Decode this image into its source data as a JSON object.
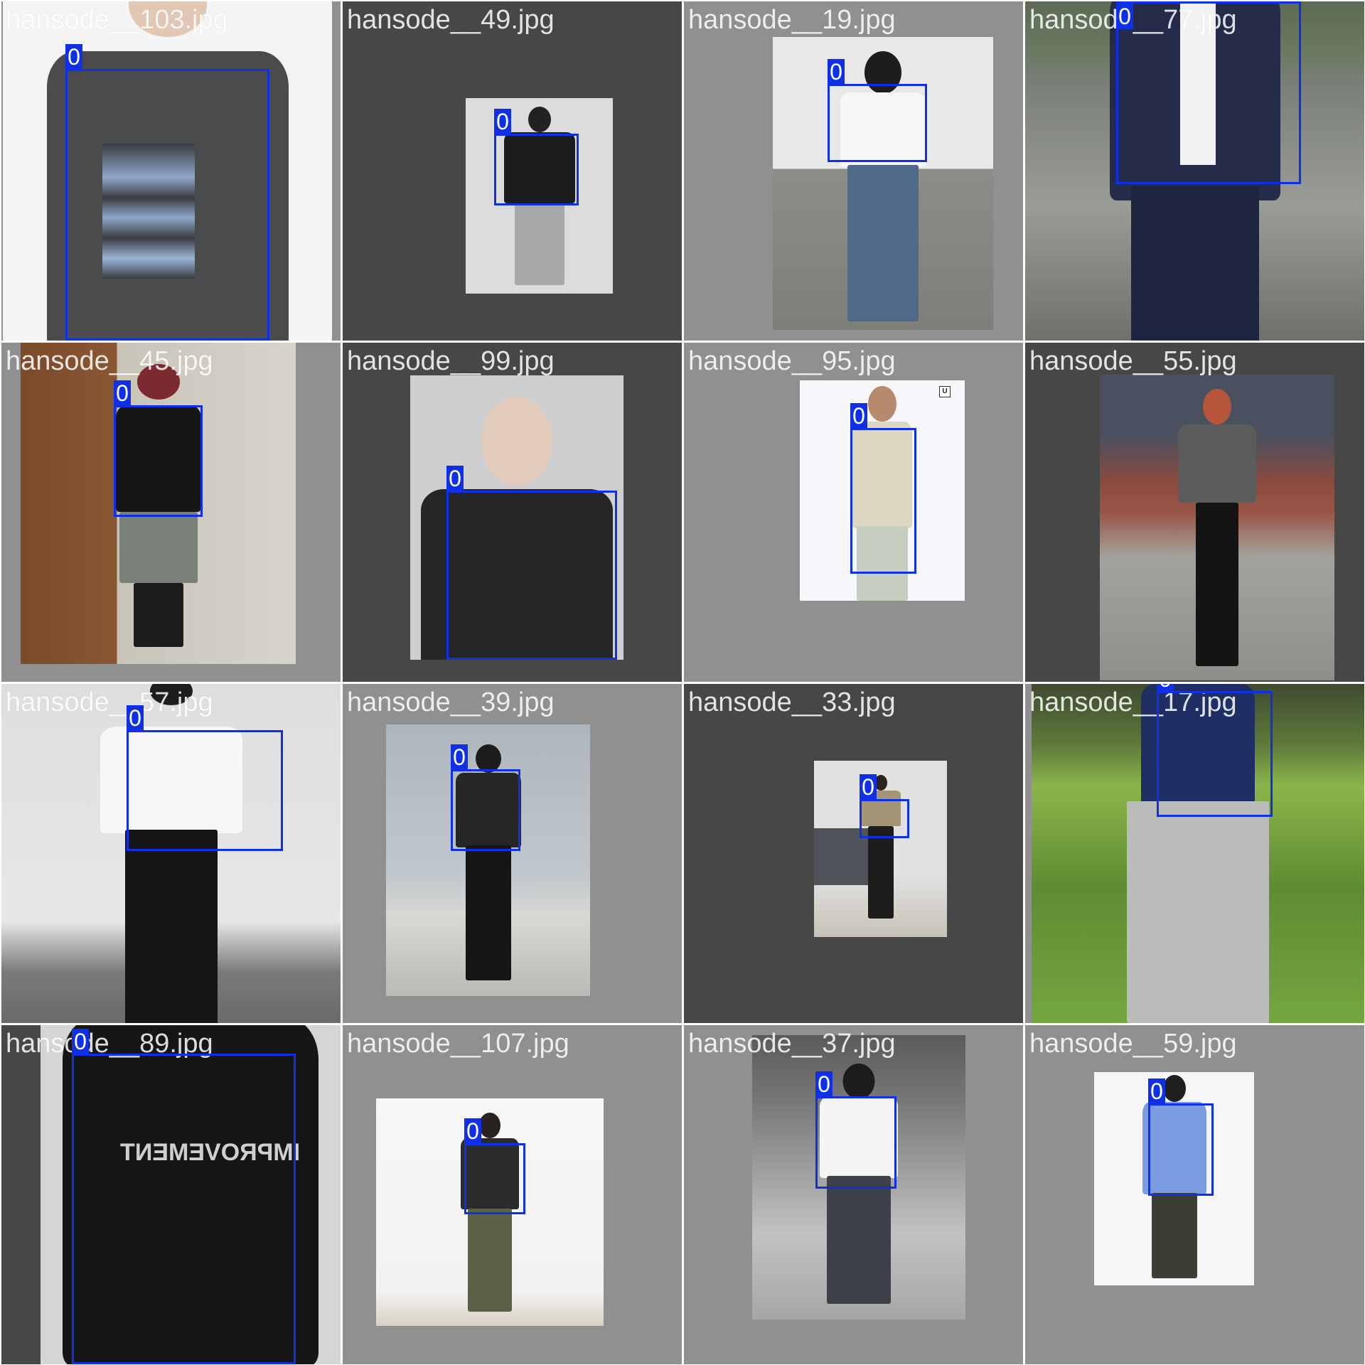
{
  "tiles": [
    {
      "file": "hansode__103.jpg",
      "label": "0"
    },
    {
      "file": "hansode__49.jpg",
      "label": "0"
    },
    {
      "file": "hansode__19.jpg",
      "label": "0"
    },
    {
      "file": "hansode__77.jpg",
      "label": "0"
    },
    {
      "file": "hansode__45.jpg",
      "label": "0"
    },
    {
      "file": "hansode__99.jpg",
      "label": "0"
    },
    {
      "file": "hansode__95.jpg",
      "label": "0"
    },
    {
      "file": "hansode__55.jpg",
      "label": "0"
    },
    {
      "file": "hansode__57.jpg",
      "label": "0"
    },
    {
      "file": "hansode__39.jpg",
      "label": "0"
    },
    {
      "file": "hansode__33.jpg",
      "label": "0"
    },
    {
      "file": "hansode__17.jpg",
      "label": "0"
    },
    {
      "file": "hansode__89.jpg",
      "label": "0"
    },
    {
      "file": "hansode__107.jpg",
      "label": "0"
    },
    {
      "file": "hansode__37.jpg",
      "label": "0"
    },
    {
      "file": "hansode__59.jpg",
      "label": "0"
    }
  ],
  "texts": {
    "shirt_print": "IMPROVEMENT",
    "logo": "U"
  },
  "colors": {
    "box": "#1030e8",
    "tile_gray": "#909090",
    "tile_dark": "#474747"
  }
}
